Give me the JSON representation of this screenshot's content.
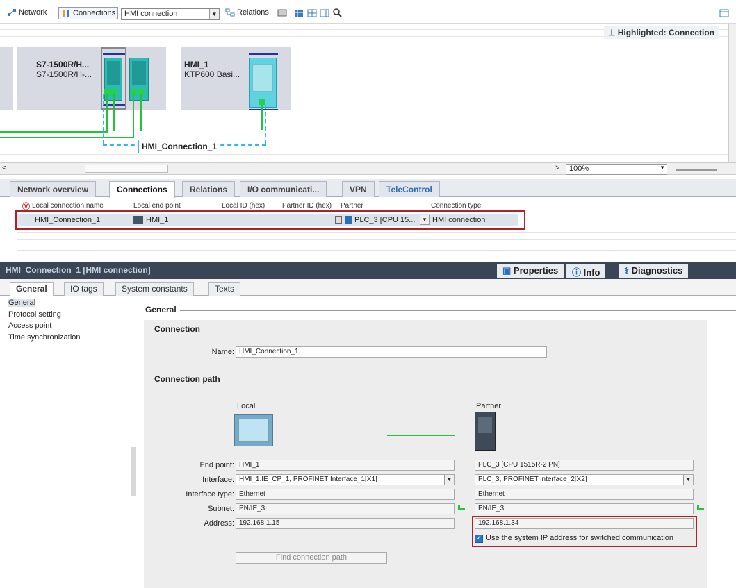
{
  "toolbar": {
    "network": "Network",
    "connections": "Connections",
    "combo": "HMI connection",
    "relations": "Relations"
  },
  "netview": {
    "highlight": "Highlighted: Connection",
    "plc": {
      "title": "S7-1500R/H...",
      "subtitle": "S7-1500R/H-..."
    },
    "hmi": {
      "title": "HMI_1",
      "subtitle": "KTP600 Basi..."
    },
    "connection_label": "HMI_Connection_1",
    "zoom": "100%"
  },
  "tabs1": [
    "Network overview",
    "Connections",
    "Relations",
    "I/O communicati...",
    "VPN",
    "TeleControl"
  ],
  "conntable": {
    "headers": [
      "Local connection name",
      "Local end point",
      "Local ID (hex)",
      "Partner ID (hex)",
      "Partner",
      "Connection type"
    ],
    "row": {
      "name": "HMI_Connection_1",
      "endpoint": "HMI_1",
      "partner": "PLC_3 [CPU 15...",
      "type": "HMI connection"
    }
  },
  "props": {
    "title": "HMI_Connection_1 [HMI connection]",
    "properties": "Properties",
    "info": "Info",
    "diagnostics": "Diagnostics"
  },
  "tabs2": [
    "General",
    "IO tags",
    "System constants",
    "Texts"
  ],
  "nav": [
    "General",
    "Protocol setting",
    "Access point",
    "Time synchronization"
  ],
  "general": {
    "header": "General",
    "connection_hdr": "Connection",
    "name_label": "Name:",
    "name_value": "HMI_Connection_1",
    "path_hdr": "Connection path",
    "local": "Local",
    "partner": "Partner",
    "labels": {
      "endpoint": "End point:",
      "interface": "Interface:",
      "interface_type": "Interface type:",
      "subnet": "Subnet:",
      "address": "Address:"
    },
    "local_vals": {
      "endpoint": "HMI_1",
      "interface": "HMI_1.IE_CP_1, PROFINET Interface_1[X1]",
      "interface_type": "Ethernet",
      "subnet": "PN/IE_3",
      "address": "192.168.1.15"
    },
    "partner_vals": {
      "endpoint": "PLC_3 [CPU 1515R-2 PN]",
      "interface": "PLC_3, PROFINET interface_2[X2]",
      "interface_type": "Ethernet",
      "subnet": "PN/IE_3",
      "address": "192.168.1.34"
    },
    "checkbox_label": "Use the system IP address for switched communication",
    "find_button": "Find connection path"
  },
  "colors": {
    "accent": "#2fb9b5",
    "highlight_border": "#b0222a",
    "connection": "#33b6f0",
    "ethernet": "#26c23e"
  }
}
